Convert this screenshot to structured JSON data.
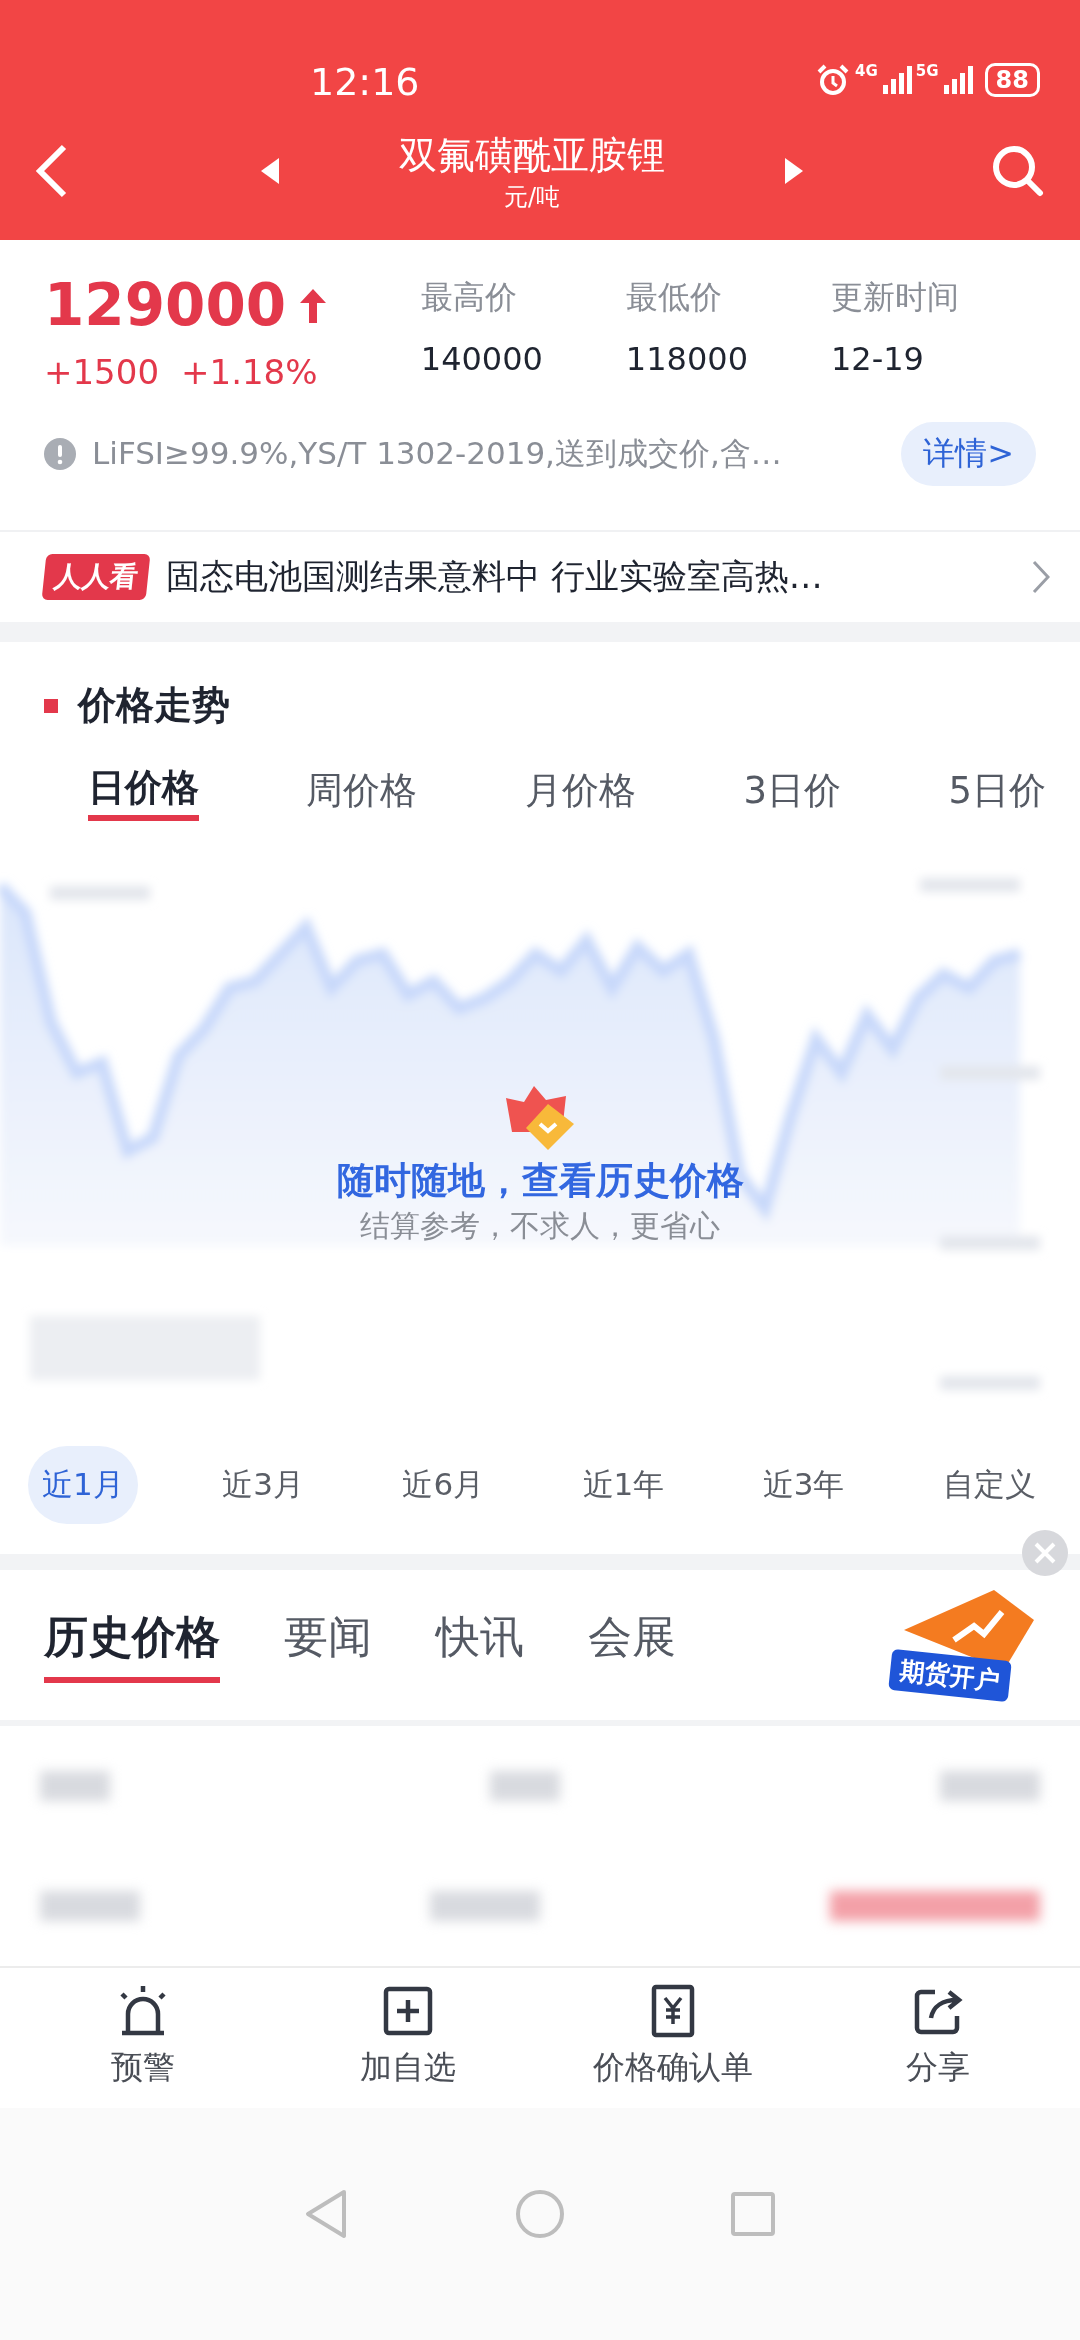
{
  "status_bar": {
    "time": "12:16",
    "network_1": "4G",
    "network_2": "5G",
    "battery": "88"
  },
  "header": {
    "title": "双氟磺酰亚胺锂",
    "unit": "元/吨"
  },
  "quote": {
    "price": "129000",
    "rising": true,
    "change": "+1500",
    "change_pct": "+1.18%",
    "stats": [
      {
        "label": "最高价",
        "value": "140000"
      },
      {
        "label": "最低价",
        "value": "118000"
      },
      {
        "label": "更新时间",
        "value": "12-19"
      }
    ],
    "note": "LiFSI≥99.9%,YS/T 1302-2019,送到成交价,含…",
    "detail_button": "详情>"
  },
  "news": {
    "badge": "人人看",
    "headline": "固态电池国测结果意料中  行业实验室高热…"
  },
  "trend_section": {
    "title": "价格走势",
    "period_tabs": [
      {
        "label": "日价格",
        "selected": true
      },
      {
        "label": "周价格",
        "selected": false
      },
      {
        "label": "月价格",
        "selected": false
      },
      {
        "label": "3日价",
        "selected": false
      },
      {
        "label": "5日价",
        "selected": false
      }
    ],
    "chart_overlay": {
      "title": "随时随地，查看历史价格",
      "subtitle": "结算参考，不求人，更省心"
    },
    "range_tabs": [
      {
        "label": "近1月",
        "selected": true
      },
      {
        "label": "近3月",
        "selected": false
      },
      {
        "label": "近6月",
        "selected": false
      },
      {
        "label": "近1年",
        "selected": false
      },
      {
        "label": "近3年",
        "selected": false
      },
      {
        "label": "自定义",
        "selected": false
      }
    ]
  },
  "content_tabs": [
    {
      "label": "历史价格",
      "selected": true
    },
    {
      "label": "要闻",
      "selected": false
    },
    {
      "label": "快讯",
      "selected": false
    },
    {
      "label": "会展",
      "selected": false
    }
  ],
  "promo": {
    "label": "期货开户"
  },
  "bottom_nav": [
    {
      "label": "预警"
    },
    {
      "label": "加自选"
    },
    {
      "label": "价格确认单"
    },
    {
      "label": "分享"
    }
  ]
}
